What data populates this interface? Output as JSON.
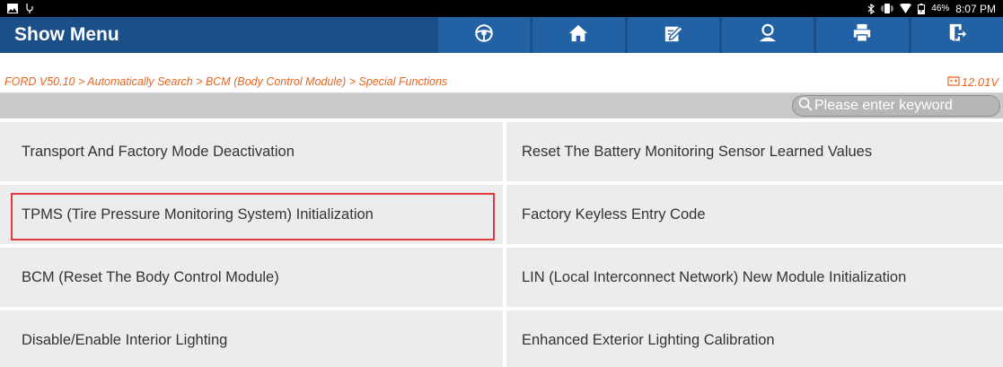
{
  "status_bar": {
    "battery_percent": "46%",
    "time": "8:07 PM"
  },
  "header": {
    "title": "Show Menu",
    "buttons": [
      {
        "name": "vehicle-button",
        "icon": "steering-wheel-icon"
      },
      {
        "name": "home-button",
        "icon": "home-icon"
      },
      {
        "name": "edit-report-button",
        "icon": "edit-icon"
      },
      {
        "name": "remote-assist-button",
        "icon": "person-icon"
      },
      {
        "name": "print-button",
        "icon": "printer-icon"
      },
      {
        "name": "exit-button",
        "icon": "exit-icon"
      }
    ]
  },
  "breadcrumb": {
    "path": "FORD V50.10 > Automatically Search > BCM (Body Control Module) > Special Functions",
    "voltage": "12.01V"
  },
  "search": {
    "placeholder": "Please enter keyword"
  },
  "menu": {
    "items": [
      {
        "label": "Transport And Factory Mode Deactivation"
      },
      {
        "label": "Reset The Battery Monitoring Sensor Learned Values"
      },
      {
        "label": "TPMS (Tire Pressure Monitoring System) Initialization",
        "highlighted": true
      },
      {
        "label": "Factory Keyless Entry Code"
      },
      {
        "label": "BCM (Reset The Body Control Module)"
      },
      {
        "label": "LIN (Local Interconnect Network) New Module Initialization"
      },
      {
        "label": "Disable/Enable Interior Lighting"
      },
      {
        "label": "Enhanced Exterior Lighting Calibration"
      }
    ]
  },
  "colors": {
    "header_bg": "#1b4f88",
    "button_bg": "#2261a3",
    "breadcrumb_text": "#e8651f",
    "highlight_border": "#e03a3a"
  }
}
